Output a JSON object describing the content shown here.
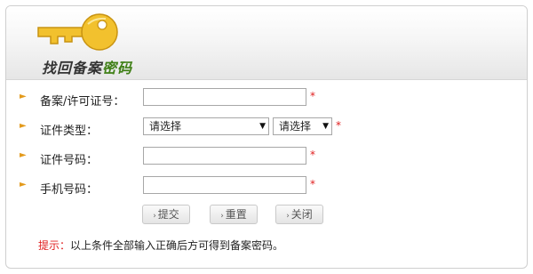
{
  "title": {
    "prefix": "找回备案",
    "accent": "密码"
  },
  "form": {
    "fields": [
      {
        "label": "备案/许可证号：",
        "value": "",
        "required_mark": "*"
      },
      {
        "label": "证件类型：",
        "required_mark": "*",
        "select1_value": "请选择",
        "select2_value": "请选择"
      },
      {
        "label": "证件号码：",
        "value": "",
        "required_mark": "*"
      },
      {
        "label": "手机号码：",
        "value": "",
        "required_mark": "*"
      }
    ]
  },
  "buttons": {
    "submit": "提交",
    "reset": "重置",
    "close": "关闭"
  },
  "tip": {
    "label": "提示：",
    "text": "以上条件全部输入正确后方可得到备案密码。"
  },
  "colors": {
    "accent_green": "#3f7f16",
    "required_red": "#e02020",
    "bullet_orange": "#e39a1b",
    "key_gold": "#f2c12e"
  }
}
